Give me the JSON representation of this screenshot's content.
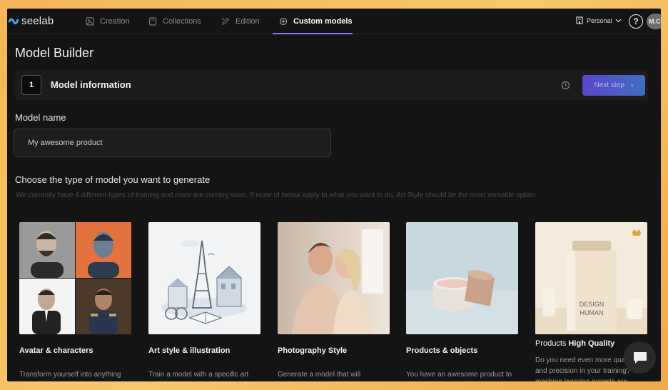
{
  "nav": {
    "logo": "seelab",
    "items": [
      {
        "label": "Creation",
        "icon": "image-icon",
        "active": false
      },
      {
        "label": "Collections",
        "icon": "folder-icon",
        "active": false
      },
      {
        "label": "Edition",
        "icon": "edit-icon",
        "active": false
      },
      {
        "label": "Custom models",
        "icon": "sparkle-icon",
        "active": true
      }
    ],
    "workspace": "Personal",
    "help": "?",
    "avatar": "M.C"
  },
  "page_title": "Model Builder",
  "step": {
    "number": "1",
    "title": "Model information",
    "next_label": "Next step"
  },
  "model_name": {
    "label": "Model name",
    "value": "My awesome product"
  },
  "model_type": {
    "heading": "Choose the type of model you want to generate",
    "helper": "We currently have 4 different types of training and more are coming soon. If none of below apply to what you want to do, Art Style should be the most versatile option"
  },
  "cards": [
    {
      "title": "Avatar & characters",
      "desc": "Transform yourself into anything"
    },
    {
      "title": "Art style & illustration",
      "desc": "Train a model with a specific art"
    },
    {
      "title": "Photography Style",
      "desc": "Generate a model that will"
    },
    {
      "title": "Products & objects",
      "desc": "You have an awesome product to"
    },
    {
      "title_light": "Products",
      "title_strong": "High Quality",
      "desc": "Do you need even more quality and precision in your training? Our machine learning experts are",
      "image_text": "DESIGN HUMAN"
    }
  ],
  "colors": {
    "accent": "#8b7cf6",
    "background": "#141414",
    "border_gradient": "#f5b55a"
  }
}
